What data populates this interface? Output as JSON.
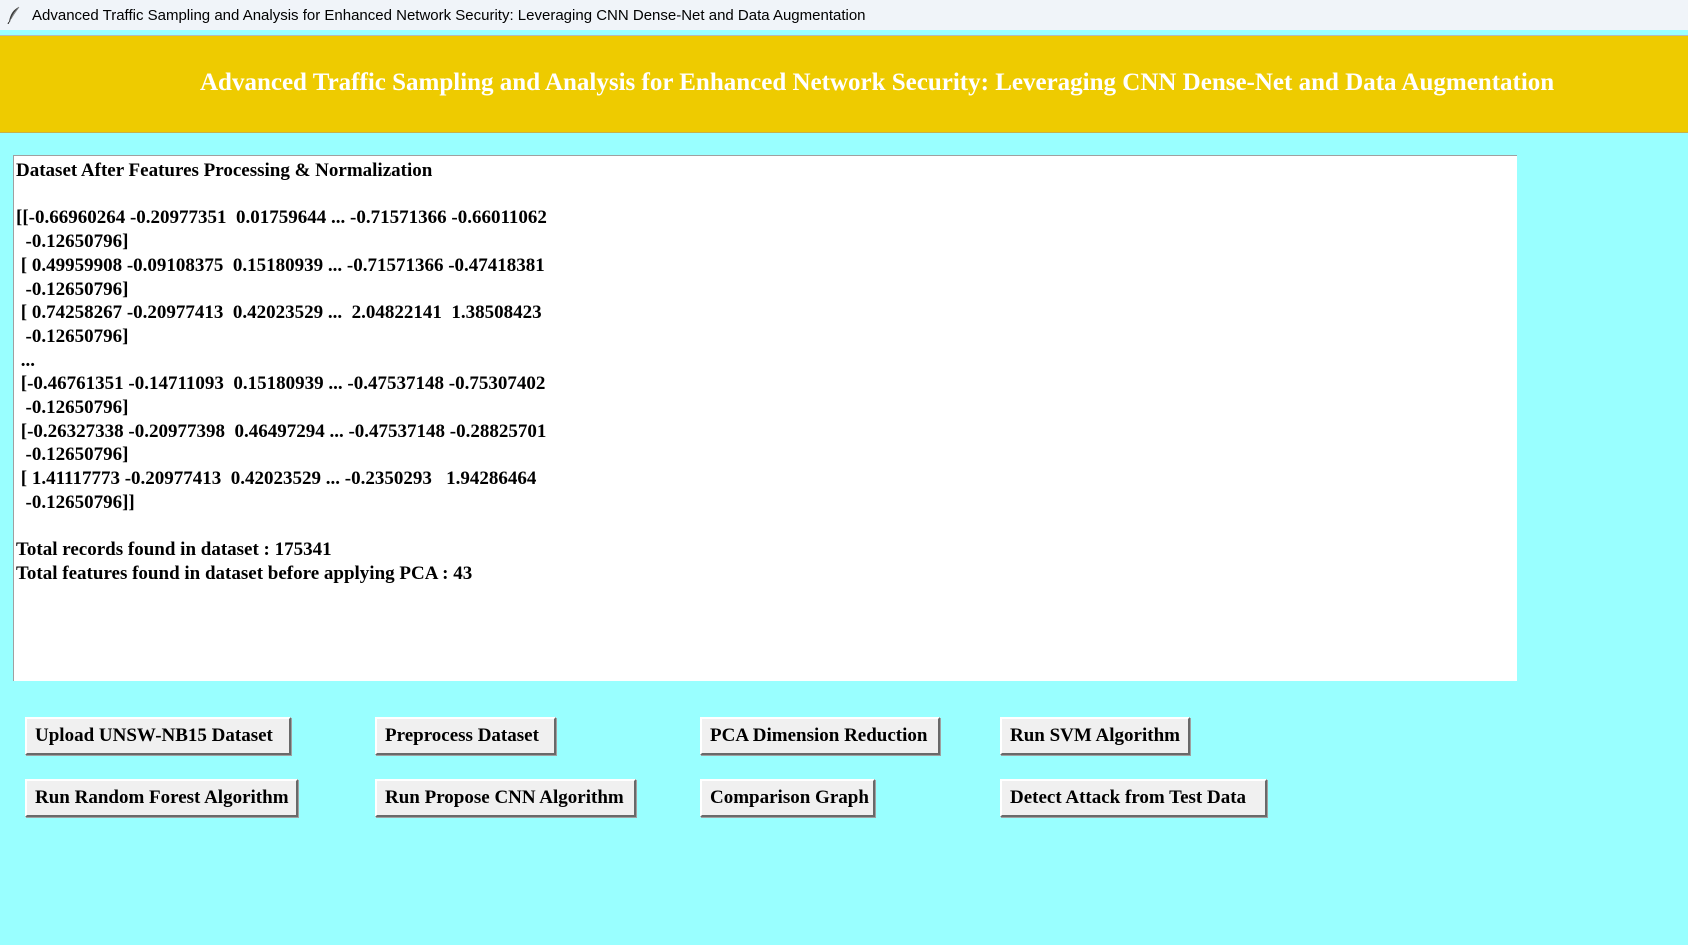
{
  "window": {
    "title": "Advanced Traffic Sampling and Analysis for Enhanced Network Security: Leveraging CNN Dense-Net and Data Augmentation",
    "icon": "feather-icon"
  },
  "header": {
    "title": "Advanced Traffic Sampling and Analysis for Enhanced Network Security: Leveraging CNN Dense-Net and Data Augmentation"
  },
  "output": {
    "lines": [
      "Dataset After Features Processing & Normalization",
      "",
      "[[-0.66960264 -0.20977351  0.01759644 ... -0.71571366 -0.66011062",
      "  -0.12650796]",
      " [ 0.49959908 -0.09108375  0.15180939 ... -0.71571366 -0.47418381",
      "  -0.12650796]",
      " [ 0.74258267 -0.20977413  0.42023529 ...  2.04822141  1.38508423",
      "  -0.12650796]",
      " ...",
      " [-0.46761351 -0.14711093  0.15180939 ... -0.47537148 -0.75307402",
      "  -0.12650796]",
      " [-0.26327338 -0.20977398  0.46497294 ... -0.47537148 -0.28825701",
      "  -0.12650796]",
      " [ 1.41117773 -0.20977413  0.42023529 ... -0.2350293   1.94286464",
      "  -0.12650796]]",
      "",
      "Total records found in dataset : 175341",
      "Total features found in dataset before applying PCA : 43"
    ]
  },
  "buttons": {
    "upload": "Upload UNSW-NB15 Dataset",
    "preprocess": "Preprocess Dataset",
    "pca": "PCA Dimension Reduction",
    "svm": "Run SVM Algorithm",
    "random_forest": "Run Random Forest Algorithm",
    "cnn": "Run Propose CNN Algorithm",
    "comparison": "Comparison Graph",
    "detect": "Detect Attack from Test Data"
  },
  "colors": {
    "background": "#99ffff",
    "header": "#eecb00",
    "header_text": "#ffffff"
  }
}
